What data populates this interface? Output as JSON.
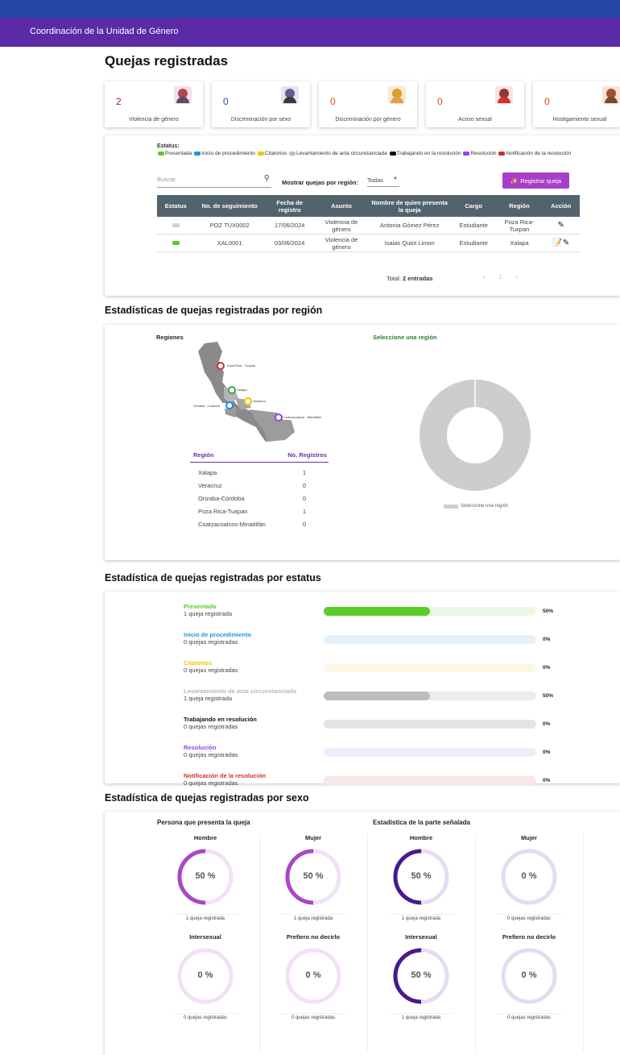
{
  "app": {
    "title": "Coordinación de la Unidad de Género"
  },
  "page": {
    "title": "Quejas registradas"
  },
  "summary_cards": [
    {
      "count": "2",
      "label": "Violencia de género"
    },
    {
      "count": "0",
      "label": "Discriminación por sexo"
    },
    {
      "count": "0",
      "label": "Discriminación por género"
    },
    {
      "count": "0",
      "label": "Acoso sexual"
    },
    {
      "count": "0",
      "label": "Hostigamiento sexual"
    }
  ],
  "status_legend": {
    "title": "Estatus:",
    "items": [
      {
        "label": "Presentada",
        "color": "#5bcc2a"
      },
      {
        "label": "Inicio de procedimiento",
        "color": "#2196d8"
      },
      {
        "label": "Citatorios",
        "color": "#f2c400"
      },
      {
        "label": "Levantamiento de acta circunstanciada",
        "color": "#bdbdbd"
      },
      {
        "label": "Trabajando en la resolución",
        "color": "#111111"
      },
      {
        "label": "Resolución",
        "color": "#8e44ef"
      },
      {
        "label": "Notificación de la resolución",
        "color": "#d32f2f"
      }
    ]
  },
  "filters": {
    "search_placeholder": "Buscar",
    "region_label": "Mostrar quejas por región:",
    "region_value": "Todas",
    "register_button": "Registrar queja"
  },
  "table": {
    "headers": [
      "Estatus",
      "No. de seguimiento",
      "Fecha de registro",
      "Asunto",
      "Nombre de quien presenta la queja",
      "Cargo",
      "Región",
      "Acción"
    ],
    "rows": [
      {
        "status_color": "#cfcfcf",
        "folio": "POZ TUX0002",
        "fecha": "17/06/2024",
        "asunto": "Violencia de género",
        "nombre": "Antonia Gómez Pérez",
        "cargo": "Estudiante",
        "region": "Poza Rica-Tuxpan"
      },
      {
        "status_color": "#5bcc2a",
        "folio": "XAL0001",
        "fecha": "03/06/2024",
        "asunto": "Violencia de género",
        "nombre": "Isaias Quiot Limon",
        "cargo": "Estudiante",
        "region": "Xalapa"
      }
    ],
    "total_label": "Total:",
    "total_value": "2 entradas",
    "page": "1"
  },
  "region_section": {
    "title": "Estadísticas de quejas registradas por región",
    "map_label": "Regiones",
    "select_prompt": "Seleccione una región",
    "map_pins": [
      "Poza Rica - Tuxpan",
      "Xalapa",
      "Veracruz",
      "Orizaba - Córdoba",
      "Coatzacoalcos - Minatitlán"
    ],
    "table_headers": [
      "Región",
      "No. Registros"
    ],
    "rows": [
      {
        "region": "Xalapa",
        "count": "1"
      },
      {
        "region": "Veracruz",
        "count": "0"
      },
      {
        "region": "Orizaba-Córdoba",
        "count": "0"
      },
      {
        "region": "Poza Rica-Tuxpan",
        "count": "1"
      },
      {
        "region": "Coatzacoalcos-Minatitlán",
        "count": "0"
      }
    ],
    "donut_legend": "Seleccione una región"
  },
  "status_section": {
    "title": "Estadística de quejas registradas por estatus",
    "items": [
      {
        "name": "Presentada",
        "count": "1 queja registrada",
        "percent": 50,
        "pct_label": "50%",
        "color": "#5bcc2a",
        "track": "#ecf8e6"
      },
      {
        "name": "Inicio de procedimiento",
        "count": "0 quejas registradas",
        "percent": 0,
        "pct_label": "0%",
        "color": "#2196d8",
        "track": "#e6f1fb"
      },
      {
        "name": "Citatorios",
        "count": "0 quejas registradas",
        "percent": 0,
        "pct_label": "0%",
        "color": "#f2c400",
        "track": "#fdf8e6"
      },
      {
        "name": "Levantamiento de acta circunstanciada",
        "count": "1 queja registrada",
        "percent": 50,
        "pct_label": "50%",
        "color": "#bdbdbd",
        "track": "#ececec"
      },
      {
        "name": "Trabajando en resolución",
        "count": "0 quejas registradas",
        "percent": 0,
        "pct_label": "0%",
        "color": "#111111",
        "track": "#e4e4e4"
      },
      {
        "name": "Resolución",
        "count": "0 quejas registradas",
        "percent": 0,
        "pct_label": "0%",
        "color": "#8e44ef",
        "track": "#f1ecfb"
      },
      {
        "name": "Notificación de la resolución",
        "count": "0 quejas registradas",
        "percent": 0,
        "pct_label": "0%",
        "color": "#d32f2f",
        "track": "#f9e8e8"
      }
    ]
  },
  "sex_section": {
    "title": "Estadística de quejas registradas por sexo",
    "left_title": "Persona que presenta la queja",
    "right_title": "Estadística de la parte señalada",
    "left": [
      {
        "label": "Hombre",
        "percent": 50,
        "pct_label": "50 %",
        "count": "1 queja registrada"
      },
      {
        "label": "Mujer",
        "percent": 50,
        "pct_label": "50 %",
        "count": "1 queja registrada"
      },
      {
        "label": "Intersexual",
        "percent": 0,
        "pct_label": "0 %",
        "count": "0 quejas registradas"
      },
      {
        "label": "Prefiero no decirlo",
        "percent": 0,
        "pct_label": "0 %",
        "count": "0 quejas registradas"
      }
    ],
    "right": [
      {
        "label": "Hombre",
        "percent": 50,
        "pct_label": "50 %",
        "count": "1 queja registrada"
      },
      {
        "label": "Mujer",
        "percent": 0,
        "pct_label": "0 %",
        "count": "0 quejas registradas"
      },
      {
        "label": "Intersexual",
        "percent": 50,
        "pct_label": "50 %",
        "count": "1 queja registrada"
      },
      {
        "label": "Prefiero no decirlo",
        "percent": 0,
        "pct_label": "0 %",
        "count": "0 quejas registradas"
      }
    ],
    "left_color": "#a848c4",
    "left_track": "#f2e1f6",
    "right_color": "#4a1a8c",
    "right_track": "#e4ddf1"
  }
}
